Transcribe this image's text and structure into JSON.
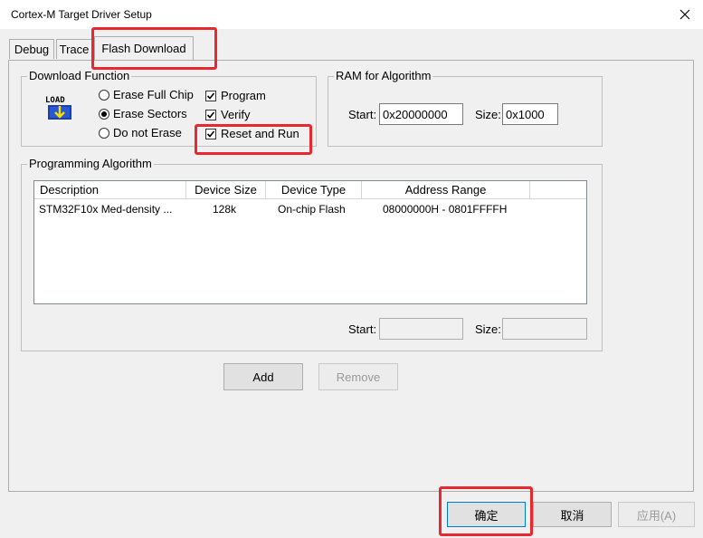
{
  "window": {
    "title": "Cortex-M Target Driver Setup"
  },
  "tabs": [
    {
      "label": "Debug"
    },
    {
      "label": "Trace"
    },
    {
      "label": "Flash Download"
    }
  ],
  "download_function": {
    "label": "Download Function",
    "icon_text": "LOAD",
    "radios": [
      {
        "label": "Erase Full Chip",
        "selected": false
      },
      {
        "label": "Erase Sectors",
        "selected": true
      },
      {
        "label": "Do not Erase",
        "selected": false
      }
    ],
    "checkboxes": [
      {
        "label": "Program",
        "checked": true
      },
      {
        "label": "Verify",
        "checked": true
      },
      {
        "label": "Reset and Run",
        "checked": true
      }
    ]
  },
  "ram_algorithm": {
    "label": "RAM for Algorithm",
    "start_label": "Start:",
    "start_value": "0x20000000",
    "size_label": "Size:",
    "size_value": "0x1000"
  },
  "programming_algorithm": {
    "label": "Programming Algorithm",
    "columns": [
      "Description",
      "Device Size",
      "Device Type",
      "Address Range"
    ],
    "rows": [
      {
        "description": "STM32F10x Med-density ...",
        "size": "128k",
        "type": "On-chip Flash",
        "range": "08000000H - 0801FFFFH"
      }
    ],
    "start_label": "Start:",
    "start_value": "",
    "size_label": "Size:",
    "size_value": ""
  },
  "buttons": {
    "add": "Add",
    "remove": "Remove",
    "ok": "确定",
    "cancel": "取消",
    "apply": "应用(A)"
  }
}
